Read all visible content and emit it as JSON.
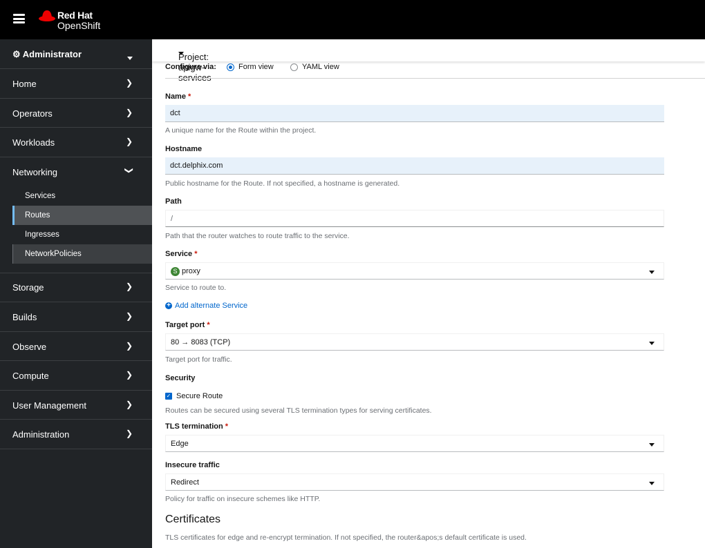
{
  "header": {
    "brand_line1": "Red Hat",
    "brand_line2": "OpenShift"
  },
  "sidebar": {
    "perspective": "Administrator",
    "items": [
      {
        "label": "Home"
      },
      {
        "label": "Operators"
      },
      {
        "label": "Workloads"
      },
      {
        "label": "Networking"
      },
      {
        "label": "Storage"
      },
      {
        "label": "Builds"
      },
      {
        "label": "Observe"
      },
      {
        "label": "Compute"
      },
      {
        "label": "User Management"
      },
      {
        "label": "Administration"
      }
    ],
    "networking_sub": [
      {
        "label": "Services"
      },
      {
        "label": "Routes"
      },
      {
        "label": "Ingresses"
      },
      {
        "label": "NetworkPolicies"
      }
    ]
  },
  "project": {
    "label": "Project: apigw-services"
  },
  "configure": {
    "label": "Configure via:",
    "form": "Form view",
    "yaml": "YAML view"
  },
  "form": {
    "name": {
      "label": "Name",
      "value": "dct",
      "help": "A unique name for the Route within the project."
    },
    "hostname": {
      "label": "Hostname",
      "value": "dct.delphix.com",
      "help": "Public hostname for the Route. If not specified, a hostname is generated."
    },
    "path": {
      "label": "Path",
      "value": "/",
      "help": "Path that the router watches to route traffic to the service."
    },
    "service": {
      "label": "Service",
      "badge": "S",
      "value": "proxy",
      "help": "Service to route to."
    },
    "add_service": "Add alternate Service",
    "target_port": {
      "label": "Target port",
      "value": "80 → 8083 (TCP)",
      "help": "Target port for traffic."
    },
    "security": {
      "label": "Security",
      "secure_route": "Secure Route",
      "secure_checked": true,
      "help": "Routes can be secured using several TLS termination types for serving certificates."
    },
    "tls": {
      "label": "TLS termination",
      "value": "Edge"
    },
    "insecure": {
      "label": "Insecure traffic",
      "value": "Redirect",
      "help": "Policy for traffic on insecure schemes like HTTP."
    },
    "certificates": {
      "title": "Certificates",
      "help": "TLS certificates for edge and re-encrypt termination. If not specified, the router&apos;s default certificate is used."
    },
    "required_mark": "*"
  }
}
